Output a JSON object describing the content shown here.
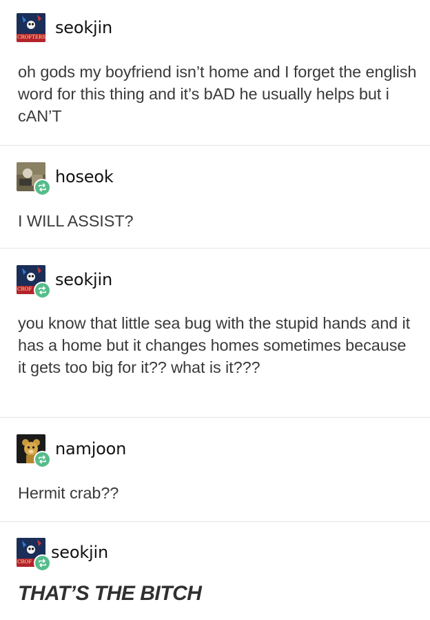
{
  "posts": [
    {
      "username": "seokjin",
      "avatar_icon": "crofters-avatar-icon",
      "avatar_caption": "CROFTERS",
      "reblog": false,
      "text": "oh gods my boyfriend isn’t home and I forget the english word for this thing and it’s bAD he usually helps but i cAN’T"
    },
    {
      "username": "hoseok",
      "avatar_icon": "hoseok-avatar-icon",
      "reblog": true,
      "text": "I WILL ASSIST?"
    },
    {
      "username": "seokjin",
      "avatar_icon": "crofters-avatar-icon",
      "avatar_caption": "CROF",
      "reblog": true,
      "text": "you know that little sea bug with the stupid hands and it has a home but it changes homes sometimes because it gets too big for it?? what is it???"
    },
    {
      "username": "namjoon",
      "avatar_icon": "bear-avatar-icon",
      "reblog": true,
      "text": "Hermit crab??"
    },
    {
      "username": "seokjin",
      "avatar_icon": "crofters-avatar-icon",
      "avatar_caption": "CROF",
      "reblog": true,
      "text": "THAT’S THE BITCH"
    }
  ],
  "colors": {
    "reblog_badge": "#56bc8a",
    "divider": "#e4e4e4",
    "text": "#3a3a3a"
  }
}
